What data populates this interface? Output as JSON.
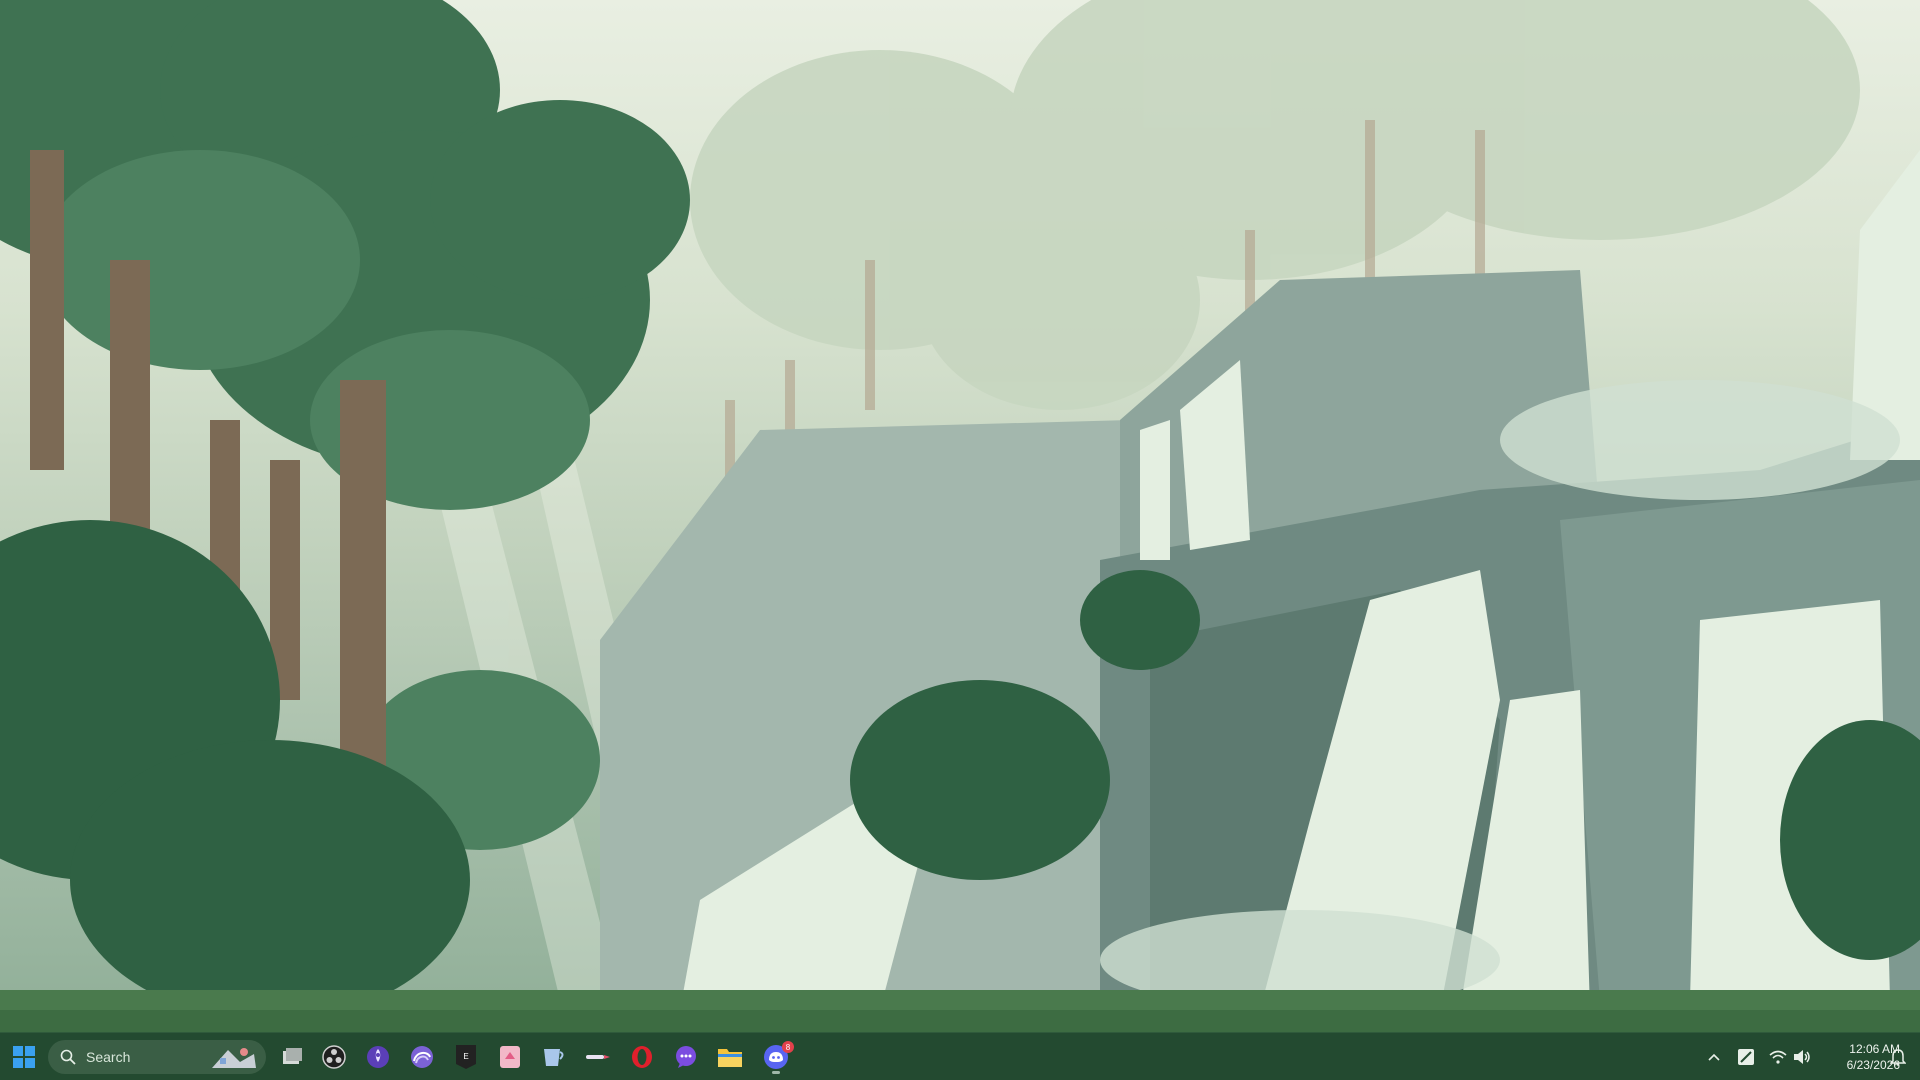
{
  "wallpaper": {
    "description_icon": "pixel-art-forest-waterfall-wallpaper"
  },
  "taskbar": {
    "start_icon": "windows-logo-icon",
    "search": {
      "placeholder": "Search",
      "label": "Search"
    },
    "pinned_apps": [
      {
        "name": "task-view",
        "icon": "task-view-icon"
      },
      {
        "name": "obs-studio",
        "icon": "obs-icon"
      },
      {
        "name": "app-purple-rocket",
        "icon": "rocket-app-icon"
      },
      {
        "name": "app-purple-spiral",
        "icon": "spiral-app-icon"
      },
      {
        "name": "epic-games",
        "icon": "epic-games-icon"
      },
      {
        "name": "app-pink-card",
        "icon": "pink-card-app-icon"
      },
      {
        "name": "app-blue-mug",
        "icon": "mug-app-icon"
      },
      {
        "name": "app-pen",
        "icon": "pen-app-icon"
      },
      {
        "name": "opera-browser",
        "icon": "opera-icon"
      },
      {
        "name": "messenger",
        "icon": "chat-bubble-icon"
      },
      {
        "name": "file-explorer",
        "icon": "folder-icon"
      },
      {
        "name": "discord",
        "icon": "discord-icon",
        "badge": "8"
      }
    ],
    "tray": {
      "chevron_icon": "chevron-up-icon",
      "pen_icon": "pen-tray-icon",
      "wifi_icon": "wifi-icon",
      "volume_icon": "speaker-icon",
      "notification_icon": "bell-icon"
    },
    "clock": {
      "time": "12:06 AM",
      "date": "6/23/2026"
    }
  },
  "colors": {
    "taskbar_bg": "#234a30",
    "search_bg": "#3a5e45",
    "accent_blue": "#3aa1f0"
  }
}
